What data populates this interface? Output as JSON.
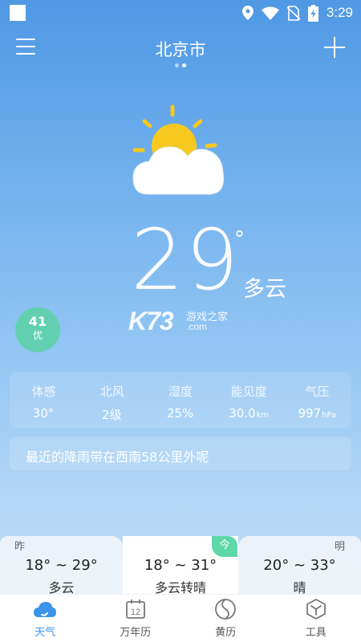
{
  "status_bar": {
    "time": "3:29",
    "icons": [
      "square-icon",
      "location-icon",
      "wifi-icon",
      "no-sim-icon",
      "battery-charging-icon"
    ]
  },
  "header": {
    "city": "北京市",
    "menu_icon": "menu-icon",
    "add_icon": "plus-icon",
    "page_indicator": {
      "pages": 2,
      "active": 2
    }
  },
  "current": {
    "icon": "partly-cloudy-icon",
    "temperature": "29",
    "degree_symbol": "°",
    "condition": "多云"
  },
  "aqi": {
    "value": "41",
    "label": "优",
    "color": "#62d0b0"
  },
  "watermark": {
    "brand": "K73",
    "site_name": "游戏之家",
    "domain": ".com"
  },
  "details": [
    {
      "label": "体感",
      "value": "30°",
      "unit": ""
    },
    {
      "label": "北风",
      "value": "2级",
      "unit": ""
    },
    {
      "label": "湿度",
      "value": "25%",
      "unit": ""
    },
    {
      "label": "能见度",
      "value": "30.0",
      "unit": "km"
    },
    {
      "label": "气压",
      "value": "997",
      "unit": "hPa"
    }
  ],
  "rain_notice": "最近的降雨带在西南58公里外呢",
  "forecast": {
    "yesterday": {
      "tag": "昨",
      "range": "18° ~ 29°",
      "condition": "多云"
    },
    "today": {
      "tag": "今",
      "range": "18° ~ 31°",
      "condition": "多云转晴"
    },
    "tomorrow": {
      "tag": "明",
      "range": "20° ~ 33°",
      "condition": "晴"
    }
  },
  "tabs": [
    {
      "label": "天气",
      "icon": "weather-cloud-icon",
      "active": true
    },
    {
      "label": "万年历",
      "icon": "calendar-icon",
      "calendar_day": "12",
      "active": false
    },
    {
      "label": "黄历",
      "icon": "almanac-icon",
      "active": false
    },
    {
      "label": "工具",
      "icon": "tools-icon",
      "active": false
    }
  ],
  "colors": {
    "sky_top": "#4f98e4",
    "sky_bottom": "#c9e2f8",
    "accent": "#3a95e8",
    "today_tag": "#5ed8a8",
    "sun": "#f7c81f"
  }
}
